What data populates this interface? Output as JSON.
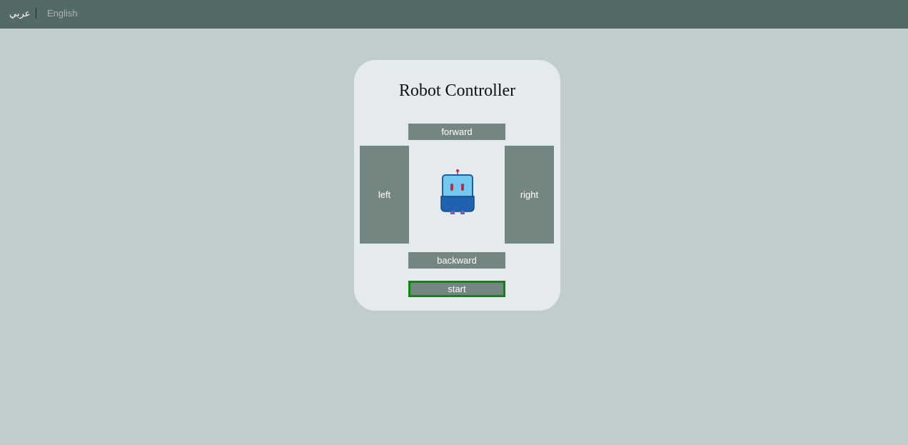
{
  "header": {
    "lang_arabic": "عربي",
    "lang_english": "English"
  },
  "controller": {
    "title": "Robot Controller",
    "forward_label": "forward",
    "left_label": "left",
    "right_label": "right",
    "backward_label": "backward",
    "start_label": "start"
  },
  "colors": {
    "topbar": "#546a66",
    "background": "#bfcdce",
    "card": "#e5ebed",
    "button": "#748681",
    "start_border": "#0a8a0a"
  },
  "icons": {
    "robot": "robot-icon"
  }
}
